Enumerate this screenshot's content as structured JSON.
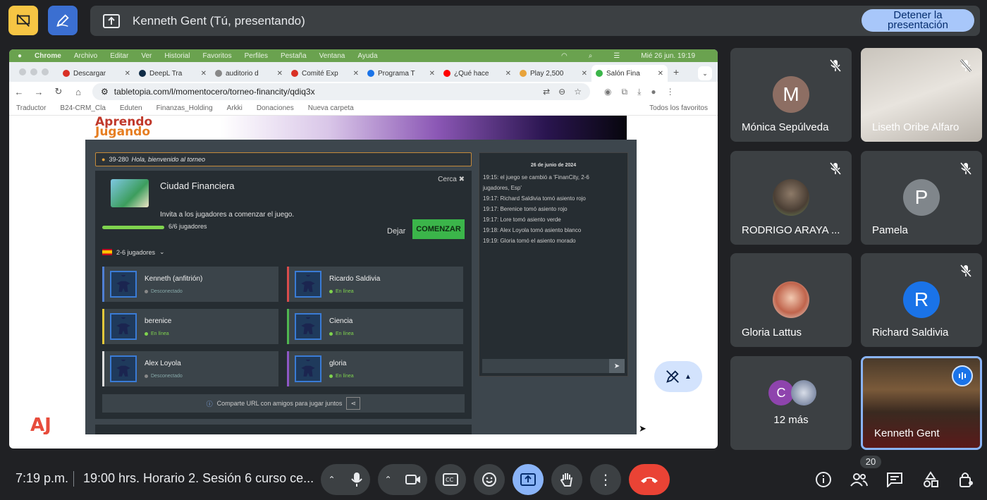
{
  "presentation": {
    "title": "Kenneth Gent (Tú, presentando)",
    "stop_label_1": "Detener la",
    "stop_label_2": "presentación"
  },
  "mac_menu": {
    "app": "Chrome",
    "items": [
      "Archivo",
      "Editar",
      "Ver",
      "Historial",
      "Favoritos",
      "Perfiles",
      "Pestaña",
      "Ventana",
      "Ayuda"
    ],
    "datetime": "Mié 26 jun.  19:19"
  },
  "browser": {
    "tabs": [
      {
        "label": "Descargar",
        "color": "#d93025"
      },
      {
        "label": "DeepL Tra",
        "color": "#0f2b46"
      },
      {
        "label": "auditorio d",
        "color": "#888888"
      },
      {
        "label": "Comité Exp",
        "color": "#d93025"
      },
      {
        "label": "Programa T",
        "color": "#1a73e8"
      },
      {
        "label": "¿Qué hace",
        "color": "#ff0000"
      },
      {
        "label": "Play 2,500",
        "color": "#e8a33b"
      },
      {
        "label": "Salón Fina",
        "color": "#3bb54a"
      }
    ],
    "url": "tabletopia.com/l/momentocero/torneo-financity/qdiq3x",
    "bookmarks": [
      "Traductor",
      "B24-CRM_Cla",
      "Eduten",
      "Finanzas_Holding",
      "Arkki",
      "Donaciones",
      "Nueva carpeta"
    ],
    "bookmarks_right": "Todos los favoritos"
  },
  "game": {
    "logo_line1": "Aprendo",
    "logo_line2": "Jugando",
    "corner_logo": "AJ",
    "welcome_code": "39-280",
    "welcome_text": "Hola, bienvenido al torneo",
    "title": "Ciudad Financiera",
    "close": "Cerca ✖",
    "invite": "Invita a los jugadores a comenzar el juego.",
    "player_count": "6/6 jugadores",
    "progress": 1.0,
    "leave": "Dejar",
    "start": "COMENZAR",
    "players_range": "2-6 jugadores",
    "players": [
      {
        "name": "Kenneth (anfitrión)",
        "status": "Desconectado",
        "online": false,
        "border": "#4f7fd3"
      },
      {
        "name": "Ricardo Saldivia",
        "status": "En línea",
        "online": true,
        "border": "#d94c4c"
      },
      {
        "name": "berenice",
        "status": "En línea",
        "online": true,
        "border": "#e3c83a"
      },
      {
        "name": "Ciencia",
        "status": "En línea",
        "online": true,
        "border": "#4fb850"
      },
      {
        "name": "Alex Loyola",
        "status": "Desconectado",
        "online": false,
        "border": "#dddddd"
      },
      {
        "name": "gloria",
        "status": "En línea",
        "online": true,
        "border": "#8e57c7"
      }
    ],
    "share": "Comparte URL con amigos para jugar juntos",
    "chat_date": "26 de junio de 2024",
    "chat_lines": [
      "19:15: el juego se cambió a 'FinanCity, 2-6",
      "jugadores, Esp'",
      "19:17: Richard Saldivia tomó asiento rojo",
      "19:17: Berenice tomó asiento rojo",
      "19:17: Lore tomó asiento verde",
      "19:18: Alex Loyola tomó asiento blanco",
      "19:19: Gloria tomó el asiento morado"
    ]
  },
  "participants": [
    {
      "name": "Mónica Sepúlveda",
      "initial": "M",
      "color": "#8d6e63",
      "muted": true
    },
    {
      "name": "Liseth Oribe Alfaro",
      "initial": "",
      "muted": true
    },
    {
      "name": "RODRIGO ARAYA ...",
      "initial": "",
      "muted": true
    },
    {
      "name": "Pamela",
      "initial": "P",
      "color": "#80868b",
      "muted": true
    },
    {
      "name": "Gloria Lattus",
      "initial": "",
      "muted": false
    },
    {
      "name": "Richard Saldivia",
      "initial": "R",
      "color": "#1a73e8",
      "muted": true
    },
    {
      "name": "12 más",
      "initial": "C",
      "color": "#8e44ad",
      "muted": false
    },
    {
      "name": "Kenneth Gent",
      "initial": "",
      "muted": false
    }
  ],
  "bottom": {
    "clock": "7:19 p.m.",
    "meeting_title": "19:00 hrs. Horario 2. Sesión 6 curso ce...",
    "participant_count": "20"
  }
}
